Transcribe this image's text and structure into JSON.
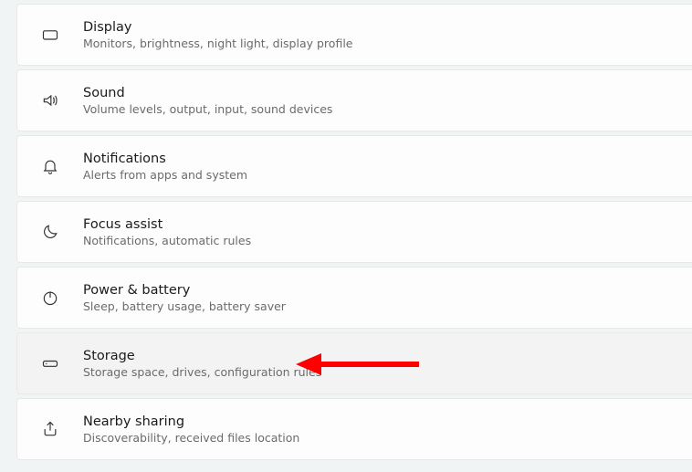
{
  "items": [
    {
      "id": "display",
      "title": "Display",
      "subtitle": "Monitors, brightness, night light, display profile"
    },
    {
      "id": "sound",
      "title": "Sound",
      "subtitle": "Volume levels, output, input, sound devices"
    },
    {
      "id": "notifications",
      "title": "Notifications",
      "subtitle": "Alerts from apps and system"
    },
    {
      "id": "focus-assist",
      "title": "Focus assist",
      "subtitle": "Notifications, automatic rules"
    },
    {
      "id": "power-battery",
      "title": "Power & battery",
      "subtitle": "Sleep, battery usage, battery saver"
    },
    {
      "id": "storage",
      "title": "Storage",
      "subtitle": "Storage space, drives, configuration rules"
    },
    {
      "id": "nearby-sharing",
      "title": "Nearby sharing",
      "subtitle": "Discoverability, received files location"
    }
  ],
  "hovered_id": "storage",
  "annotation": {
    "type": "arrow",
    "target_id": "storage",
    "color": "#ff0000"
  }
}
